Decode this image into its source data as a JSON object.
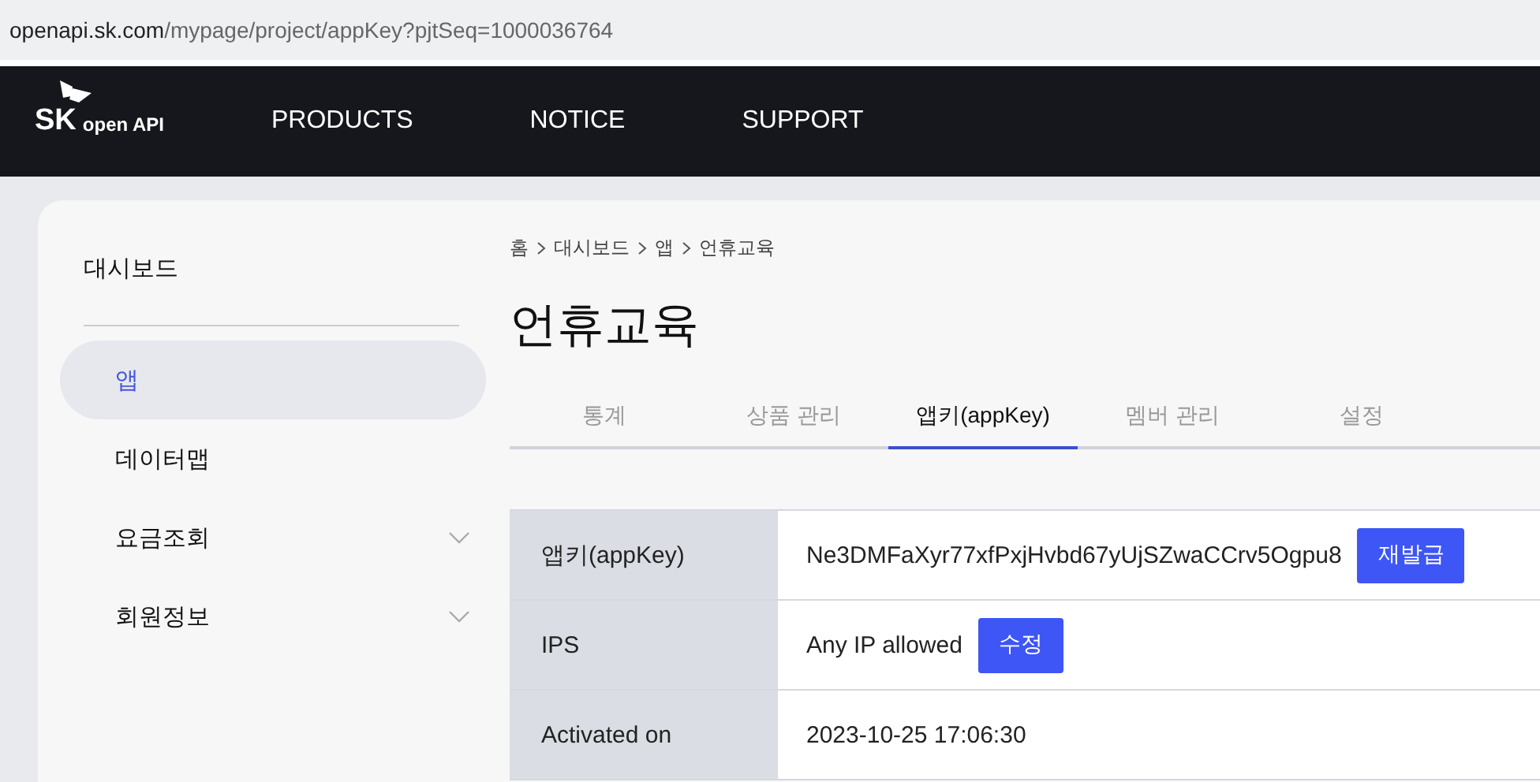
{
  "address_bar": {
    "url_host": "openapi.sk.com",
    "url_path": "/mypage/project/appKey?pjtSeq=1000036764"
  },
  "nav": {
    "logo_mark": "SK",
    "logo_text": "open API",
    "items": [
      "PRODUCTS",
      "NOTICE",
      "SUPPORT"
    ]
  },
  "sidebar": {
    "heading": "대시보드",
    "items": [
      {
        "label": "앱",
        "selected": true,
        "expandable": false
      },
      {
        "label": "데이터맵",
        "selected": false,
        "expandable": false
      },
      {
        "label": "요금조회",
        "selected": false,
        "expandable": true
      },
      {
        "label": "회원정보",
        "selected": false,
        "expandable": true
      }
    ]
  },
  "breadcrumb": [
    "홈",
    "대시보드",
    "앱",
    "언휴교육"
  ],
  "page_title": "언휴교육",
  "tabs": [
    {
      "label": "통계",
      "selected": false
    },
    {
      "label": "상품 관리",
      "selected": false
    },
    {
      "label": "앱키(appKey)",
      "selected": true
    },
    {
      "label": "멤버 관리",
      "selected": false
    },
    {
      "label": "설정",
      "selected": false
    }
  ],
  "details": [
    {
      "label": "앱키(appKey)",
      "value": "Ne3DMFaXyr77xfPxjHvbd67yUjSZwaCCrv5Ogpu8",
      "button": "재발급"
    },
    {
      "label": "IPS",
      "value": "Any IP allowed",
      "button": "수정"
    },
    {
      "label": "Activated on",
      "value": "2023-10-25 17:06:30"
    }
  ]
}
